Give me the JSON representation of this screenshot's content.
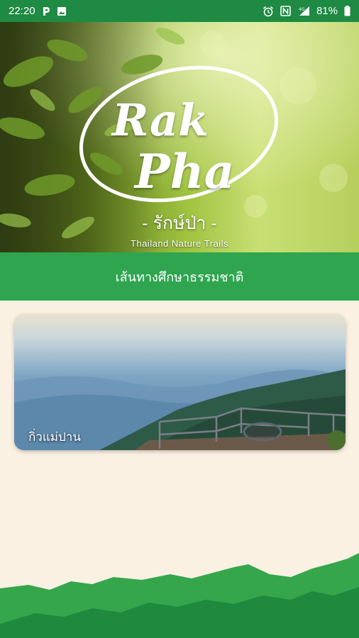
{
  "status_bar": {
    "time": "22:20",
    "battery": "81%",
    "left_icons": [
      "parking-icon",
      "image-icon"
    ],
    "right_icons": [
      "alarm-icon",
      "nfc-icon",
      "signal-icon",
      "battery-icon"
    ]
  },
  "hero": {
    "logo_line1": "Rak",
    "logo_line2": "Pha",
    "logo_thai": "- รักษ์ป่า -",
    "logo_tagline": "Thailand Nature Trails"
  },
  "section_title": "เส้นทางศึกษาธรรมชาติ",
  "trails": [
    {
      "name": "กิ่วแม่ปาน"
    }
  ],
  "colors": {
    "status_bar": "#1f8a43",
    "title_band": "#30a550",
    "background": "#fbf1e3",
    "mountain_light": "#35a64c",
    "mountain_dark": "#1f8a3e"
  }
}
